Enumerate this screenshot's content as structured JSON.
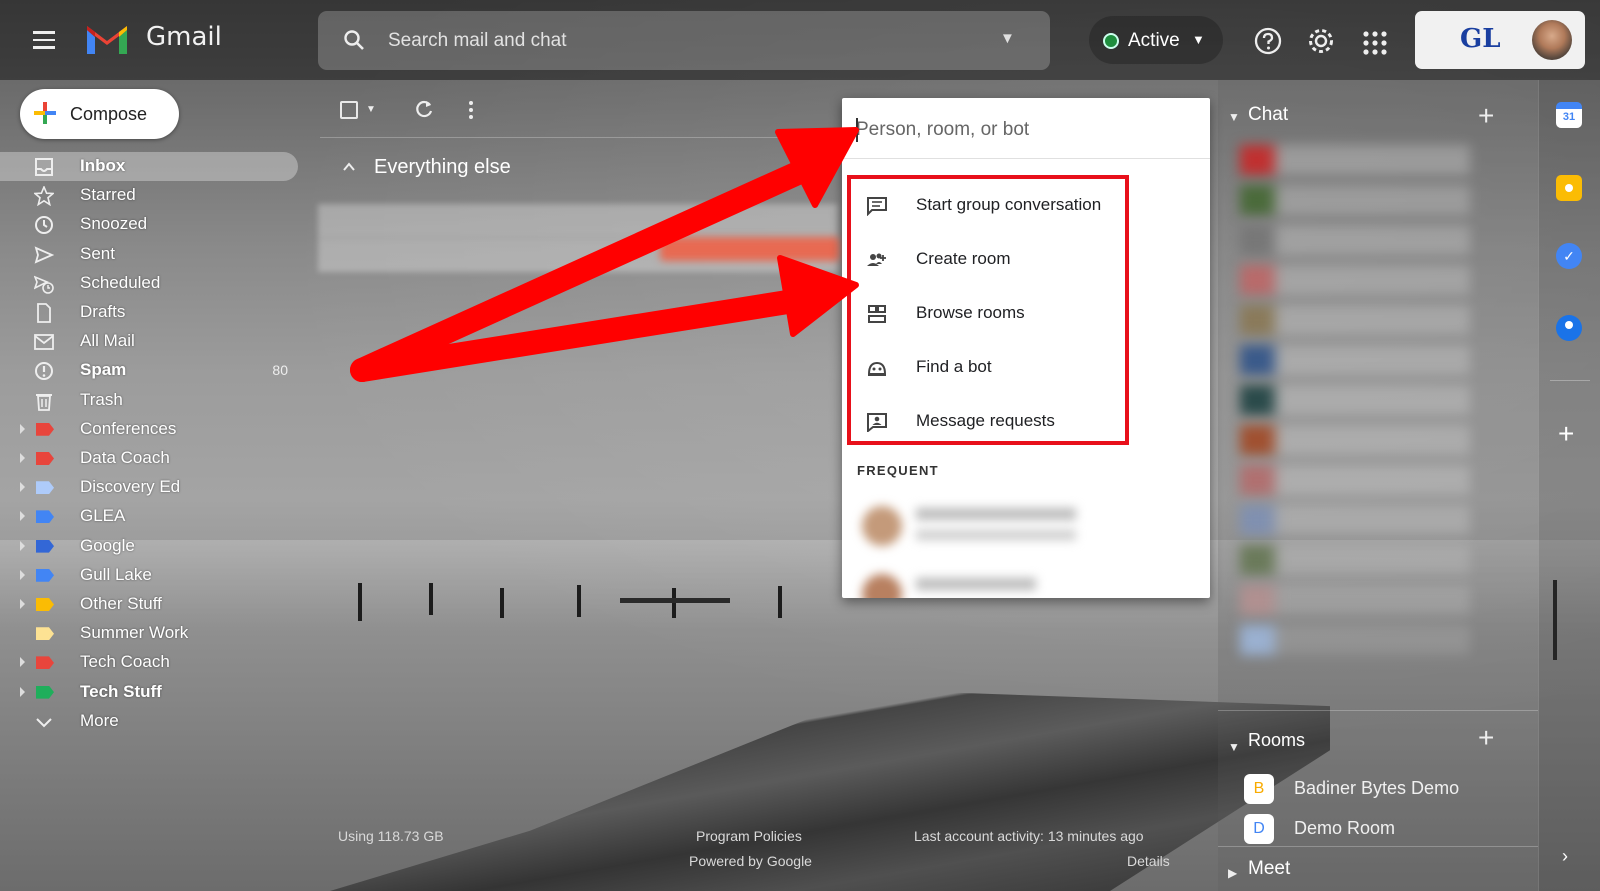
{
  "app": {
    "name": "Gmail"
  },
  "search": {
    "placeholder": "Search mail and chat"
  },
  "status": {
    "label": "Active",
    "color": "#1e8e3e"
  },
  "header_icons": [
    "menu-icon",
    "help-icon",
    "gear-icon",
    "apps-icon"
  ],
  "account": {
    "org_logo_text": "GL"
  },
  "compose": {
    "label": "Compose"
  },
  "nav": [
    {
      "label": "Inbox",
      "icon": "inbox-icon",
      "active": true,
      "bold": true
    },
    {
      "label": "Starred",
      "icon": "star-icon"
    },
    {
      "label": "Snoozed",
      "icon": "clock-icon"
    },
    {
      "label": "Sent",
      "icon": "send-icon"
    },
    {
      "label": "Scheduled",
      "icon": "scheduled-send-icon"
    },
    {
      "label": "Drafts",
      "icon": "draft-icon"
    },
    {
      "label": "All Mail",
      "icon": "mail-icon"
    },
    {
      "label": "Spam",
      "icon": "spam-icon",
      "count": "80",
      "bold": true
    },
    {
      "label": "Trash",
      "icon": "trash-icon"
    },
    {
      "label": "Conferences",
      "tag_color": "#e8453c",
      "expandable": true
    },
    {
      "label": "Data Coach",
      "tag_color": "#e8453c",
      "expandable": true
    },
    {
      "label": "Discovery Ed",
      "tag_color": "#aecbfa",
      "expandable": true
    },
    {
      "label": "GLEA",
      "tag_color": "#4285f4",
      "expandable": true
    },
    {
      "label": "Google",
      "tag_color": "#3367d6",
      "expandable": true
    },
    {
      "label": "Gull Lake",
      "tag_color": "#4285f4",
      "expandable": true
    },
    {
      "label": "Other Stuff",
      "tag_color": "#fbbc04",
      "expandable": true
    },
    {
      "label": "Summer Work",
      "tag_color": "#fde293"
    },
    {
      "label": "Tech Coach",
      "tag_color": "#e8453c",
      "expandable": true
    },
    {
      "label": "Tech Stuff",
      "tag_color": "#1fae5b",
      "expandable": true,
      "bold": true
    },
    {
      "label": "More",
      "icon": "chevron-down-icon"
    }
  ],
  "inbox": {
    "section_title": "Everything else"
  },
  "footer": {
    "storage": "Using 118.73 GB",
    "policies": "Program Policies",
    "powered": "Powered by Google",
    "activity": "Last account activity: 13 minutes ago",
    "details": "Details"
  },
  "popup": {
    "placeholder": "Person, room, or bot",
    "items": [
      {
        "label": "Start group conversation",
        "icon": "chat-bubble-icon"
      },
      {
        "label": "Create room",
        "icon": "group-add-icon"
      },
      {
        "label": "Browse rooms",
        "icon": "room-grid-icon"
      },
      {
        "label": "Find a bot",
        "icon": "bot-icon"
      },
      {
        "label": "Message requests",
        "icon": "person-message-icon"
      }
    ],
    "frequent_heading": "FREQUENT"
  },
  "chat": {
    "title": "Chat"
  },
  "rooms": {
    "title": "Rooms",
    "items": [
      {
        "badge": "B",
        "label": "Badiner Bytes Demo",
        "badge_color": "#f9ab00"
      },
      {
        "badge": "D",
        "label": "Demo Room",
        "badge_color": "#4285f4"
      }
    ]
  },
  "meet": {
    "title": "Meet"
  },
  "rail": [
    {
      "icon": "calendar-icon",
      "color": "#4285f4"
    },
    {
      "icon": "keep-icon",
      "color": "#fbbc04"
    },
    {
      "icon": "tasks-icon",
      "color": "#4285f4"
    },
    {
      "icon": "contacts-icon",
      "color": "#1a73e8"
    }
  ],
  "annotation": {
    "arrow_color": "#ff0000",
    "box_color": "#e8101a"
  }
}
